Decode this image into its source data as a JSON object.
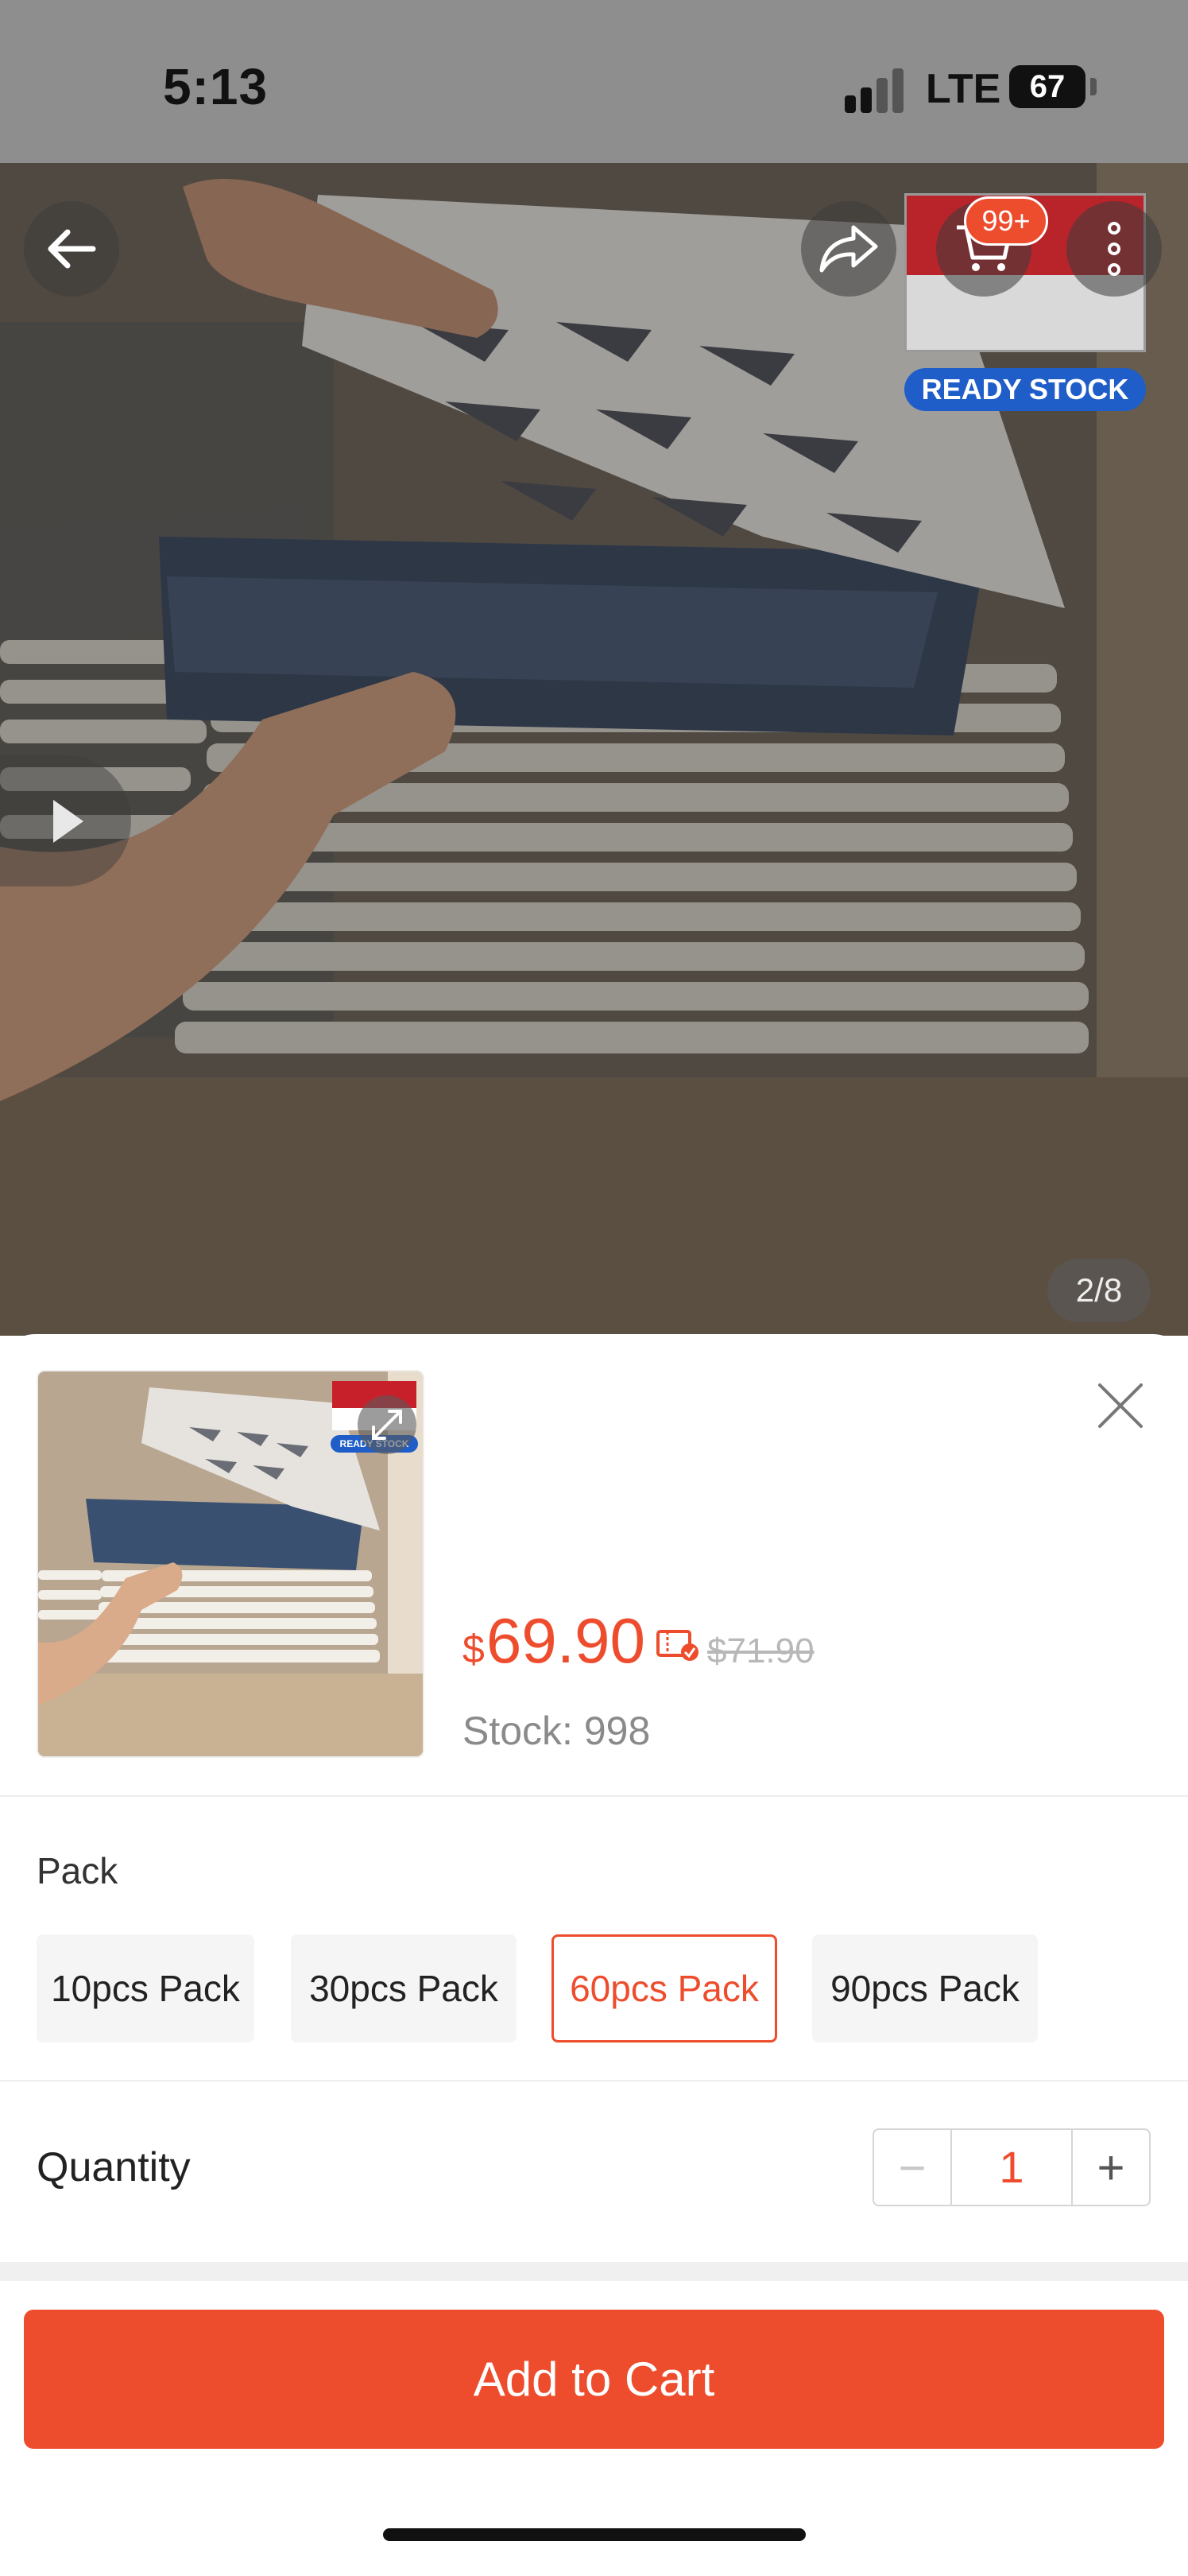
{
  "status_bar": {
    "time": "5:13",
    "network": "LTE",
    "battery": "67"
  },
  "hero": {
    "cart_badge": "99+",
    "ready_stock": "READY STOCK",
    "page_indicator": "2/8",
    "icons": [
      "back-arrow-icon",
      "share-icon",
      "cart-icon",
      "more-vertical-icon",
      "play-icon"
    ]
  },
  "product": {
    "currency": "$",
    "price": "69.90",
    "original_price": "$71.90",
    "stock": "Stock: 998",
    "thumb_ready": "READY STOCK"
  },
  "variation": {
    "label": "Pack",
    "options": [
      {
        "label": "10pcs Pack",
        "selected": false
      },
      {
        "label": "30pcs Pack",
        "selected": false
      },
      {
        "label": "60pcs Pack",
        "selected": true
      },
      {
        "label": "90pcs Pack",
        "selected": false
      }
    ]
  },
  "quantity": {
    "label": "Quantity",
    "value": "1",
    "minus": "−",
    "plus": "+"
  },
  "cta": {
    "label": "Add to Cart"
  },
  "colors": {
    "accent": "#ee4d2d",
    "ready_stock_blue": "#1f5ec8"
  }
}
